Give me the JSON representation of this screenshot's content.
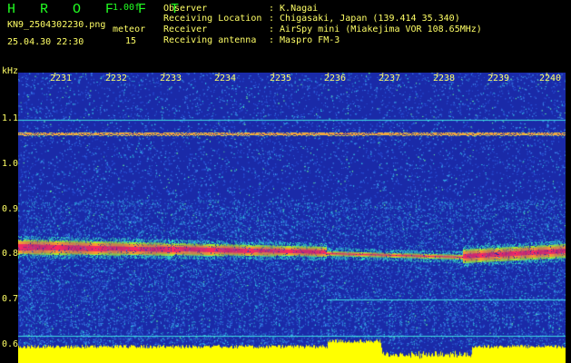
{
  "header": {
    "title": "H R O F F T",
    "version": "1.00f",
    "filename": "KN9_2504302230.png",
    "meteor_label": "meteor",
    "datetime": "25.04.30 22:30",
    "meteor_count": "15"
  },
  "info": [
    {
      "key": "Observer",
      "value": ": K.Nagai"
    },
    {
      "key": "Receiving Location",
      "value": ": Chigasaki, Japan (139.414 35.340)"
    },
    {
      "key": "Receiver",
      "value": ": AirSpy mini (Miakejima VOR 108.65MHz)"
    },
    {
      "key": "Receiving antenna",
      "value": ": Maspro FM-3"
    }
  ],
  "axis": {
    "unit": "kHz",
    "freq_labels": [
      "1.1",
      "1.0",
      "0.9",
      "0.8",
      "0.7",
      "0.6"
    ],
    "time_labels": [
      "2231",
      "2232",
      "2233",
      "2234",
      "2235",
      "2236",
      "2237",
      "2238",
      "2239",
      "2240"
    ]
  },
  "colors": {
    "background": "#000000",
    "title": "#22ff22",
    "text": "#ffff66",
    "spectrogram_base": "#1a2aa8",
    "signal": "#ff2a60",
    "noise_floor": "#ffff00"
  }
}
